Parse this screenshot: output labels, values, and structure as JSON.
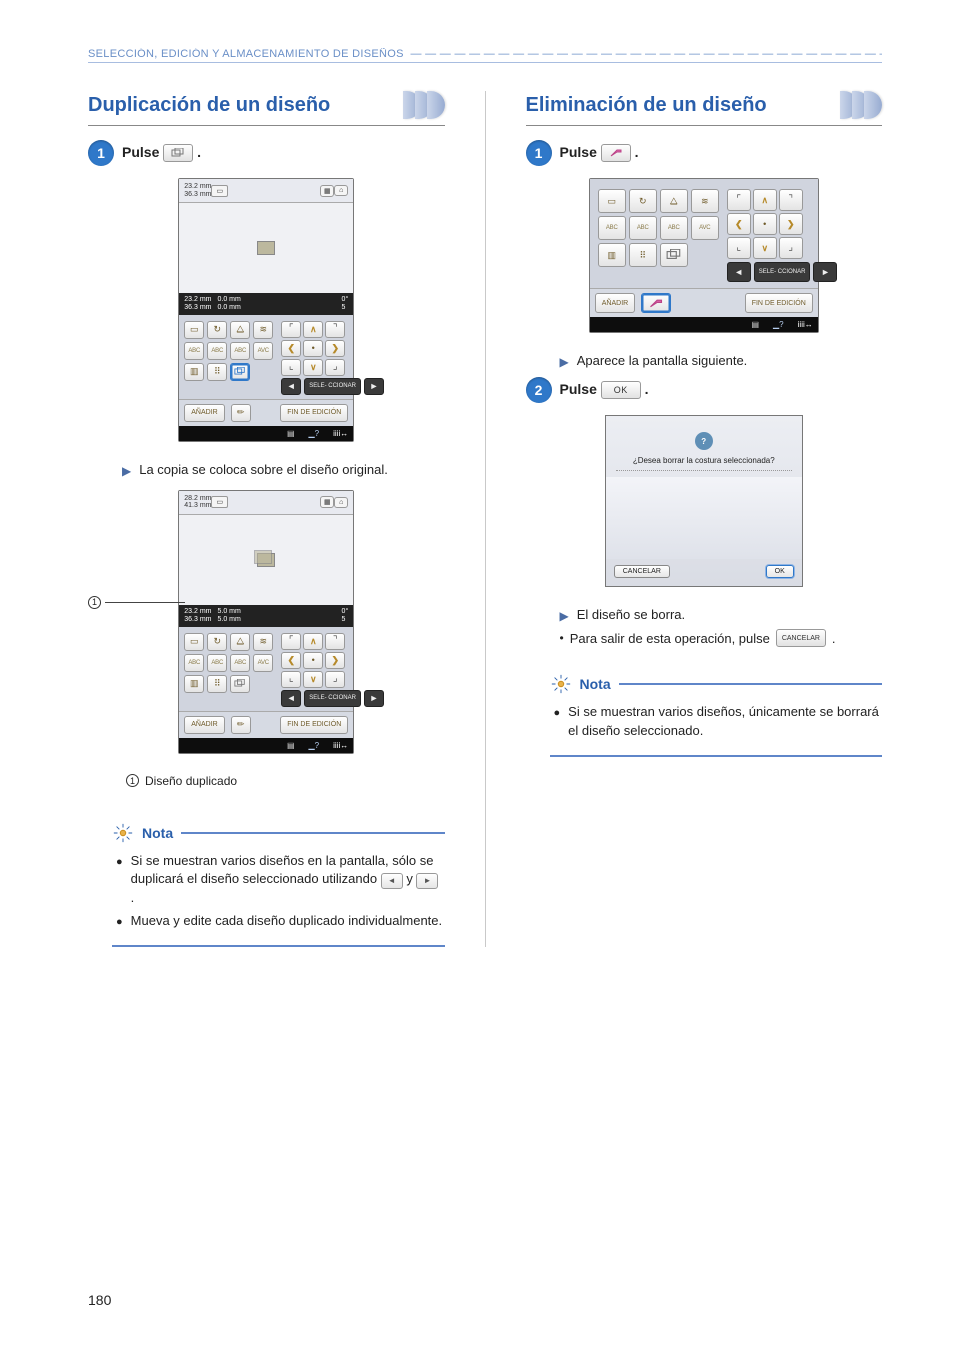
{
  "header": "SELECCIÓN, EDICIÓN Y ALMACENAMIENTO DE DISEÑOS",
  "page_number": "180",
  "left": {
    "title": "Duplicación de un diseño",
    "step1": {
      "num": "1",
      "label": "Pulse",
      "btn_icon": "duplicate-icon",
      "period": "."
    },
    "screen1": {
      "dim_h": "23.2 mm",
      "dim_w": "36.3 mm",
      "mid_h": "23.2 mm",
      "mid_w": "36.3 mm",
      "off_a": "0.0 mm",
      "off_b": "0.0 mm",
      "angle": "0°",
      "count": "5",
      "select_label": "SELE-\nCCIONAR",
      "add": "AÑADIR",
      "end": "FIN DE\nEDICIÓN"
    },
    "result1": "La copia se coloca sobre el diseño original.",
    "screen2": {
      "dim_h": "28.2 mm",
      "dim_w": "41.3 mm",
      "mid_h": "23.2 mm",
      "mid_w": "36.3 mm",
      "off_a": "5.0 mm",
      "off_b": "5.0 mm",
      "angle": "0°",
      "count": "5",
      "select_label": "SELE-\nCCIONAR",
      "add": "AÑADIR",
      "end": "FIN DE\nEDICIÓN"
    },
    "legend1_num": "1",
    "legend1": "Diseño duplicado",
    "note_title": "Nota",
    "note_items": [
      "Si se muestran varios diseños en la pantalla, sólo se duplicará el diseño seleccionado utilizando",
      "Mueva y edite cada diseño duplicado individualmente."
    ],
    "note_y": "y",
    "note_period": "."
  },
  "right": {
    "title": "Eliminación de un diseño",
    "step1": {
      "num": "1",
      "label": "Pulse",
      "btn_icon": "delete-icon",
      "period": "."
    },
    "screen1": {
      "abc1": "ABC",
      "abc2": "ABC",
      "abc3": "ABC",
      "avc": "AVC",
      "select_label": "SELE-\nCCIONAR",
      "add": "AÑADIR",
      "end": "FIN DE\nEDICIÓN"
    },
    "result1": "Aparece la pantalla siguiente.",
    "step2": {
      "num": "2",
      "label": "Pulse",
      "btn_label": "OK",
      "period": "."
    },
    "dialog": {
      "text": "¿Desea borrar la costura seleccionada?",
      "cancel": "CANCELAR",
      "ok": "OK"
    },
    "result2": "El diseño se borra.",
    "bullet": "Para salir de esta operación, pulse",
    "bullet_btn": "CANCELAR",
    "bullet_period": ".",
    "note_title": "Nota",
    "note_item": "Si se muestran varios diseños, únicamente se borrará el diseño seleccionado."
  },
  "icons": {
    "arrows": {
      "l": "◄",
      "r": "►",
      "u": "▲",
      "d": "▼"
    },
    "q": "?"
  }
}
